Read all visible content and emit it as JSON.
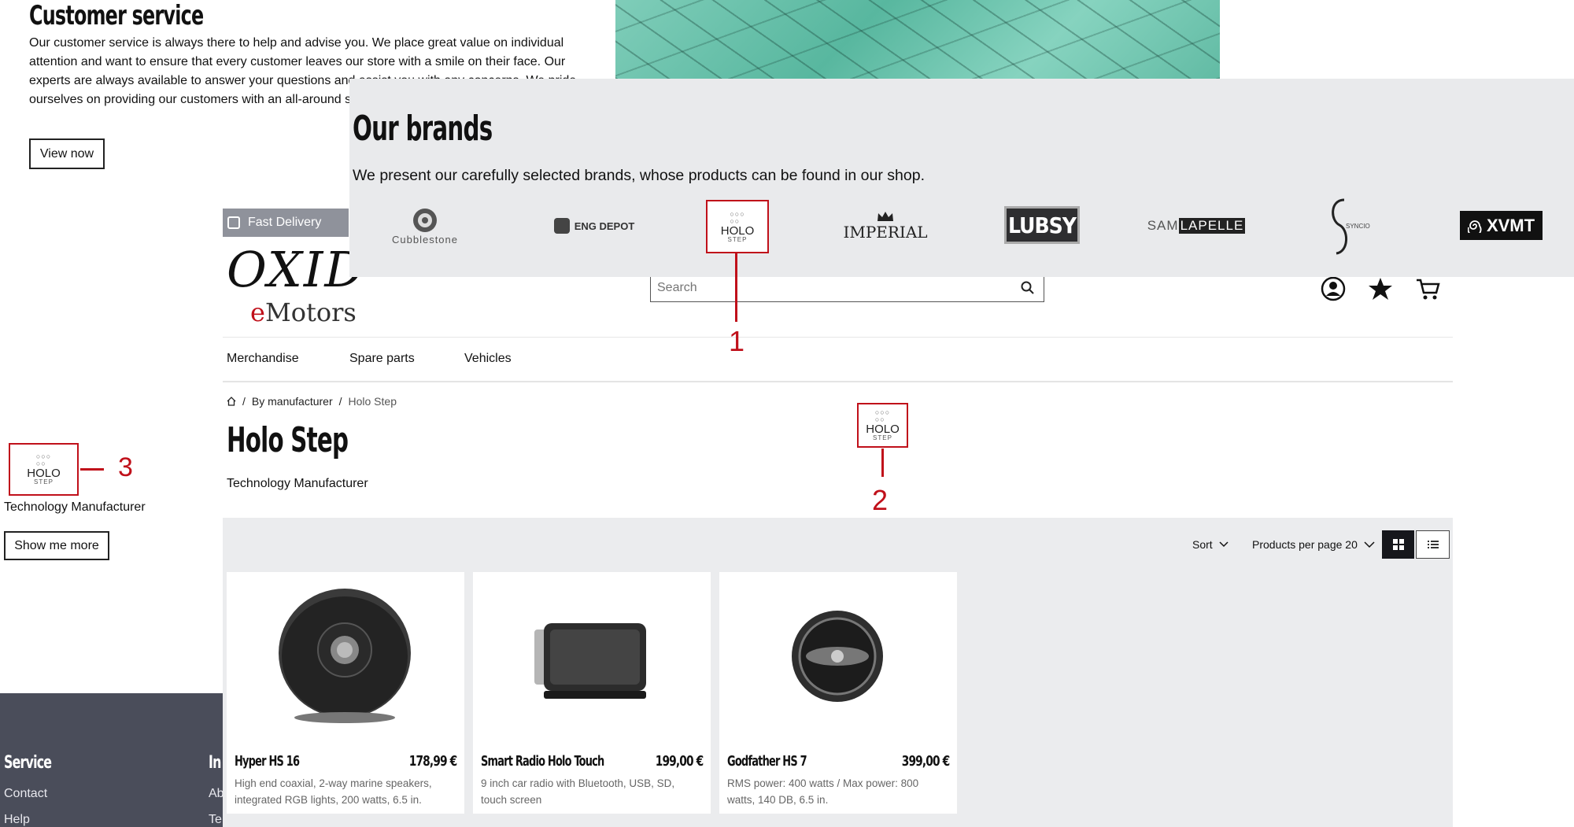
{
  "customer_service": {
    "title": "Customer service",
    "text": "Our customer service is always there to help and advise you. We place great value on individual attention and want to ensure that every customer leaves our store with a smile on their face. Our experts are always available to answer your questions and assist you with any concerns. We pride ourselves on providing our customers with an all-around s... hearing from you.",
    "button": "View now"
  },
  "brands": {
    "title": "Our brands",
    "subtitle": "We present our carefully selected brands, whose products can be found in our shop.",
    "items": [
      "Cubblestone",
      "ENG DEPOT",
      "HOLO STEP",
      "IMPERIAL",
      "LUBSY",
      "SAM",
      "LAPELLE",
      "SYNCIO",
      "XVMT"
    ],
    "callout": "1"
  },
  "header": {
    "fast_delivery": "Fast Delivery",
    "logo_top": "OXID",
    "logo_bottom_e": "e",
    "logo_bottom": "Motors",
    "search_placeholder": "Search"
  },
  "nav": {
    "items": [
      "Merchandise",
      "Spare parts",
      "Vehicles"
    ]
  },
  "breadcrumb": {
    "sep": "/",
    "by_manufacturer": "By manufacturer",
    "current": "Holo Step"
  },
  "manufacturer": {
    "title": "Holo Step",
    "description": "Technology Manufacturer",
    "logo_top": "HOLO",
    "logo_bottom": "STEP",
    "callout": "2"
  },
  "toolbar": {
    "sort": "Sort",
    "per_page": "Products per page 20"
  },
  "products": [
    {
      "name": "Hyper HS 16",
      "price": "178,99 €",
      "desc": "High end coaxial, 2-way marine speakers, integrated RGB lights, 200 watts, 6.5 in."
    },
    {
      "name": "Smart Radio Holo Touch",
      "price": "199,00 €",
      "desc": "9 inch car radio with Bluetooth, USB, SD, touch screen"
    },
    {
      "name": "Godfather HS 7",
      "price": "399,00 €",
      "desc": "RMS power: 400 watts / Max power: 800 watts, 140 DB, 6.5 in."
    }
  ],
  "left_widget": {
    "description": "Technology Manufacturer",
    "button": "Show me more",
    "callout": "3"
  },
  "footer": {
    "service": "Service",
    "in": "In",
    "contact": "Contact",
    "help": "Help",
    "ab": "Ab",
    "te": "Te"
  }
}
